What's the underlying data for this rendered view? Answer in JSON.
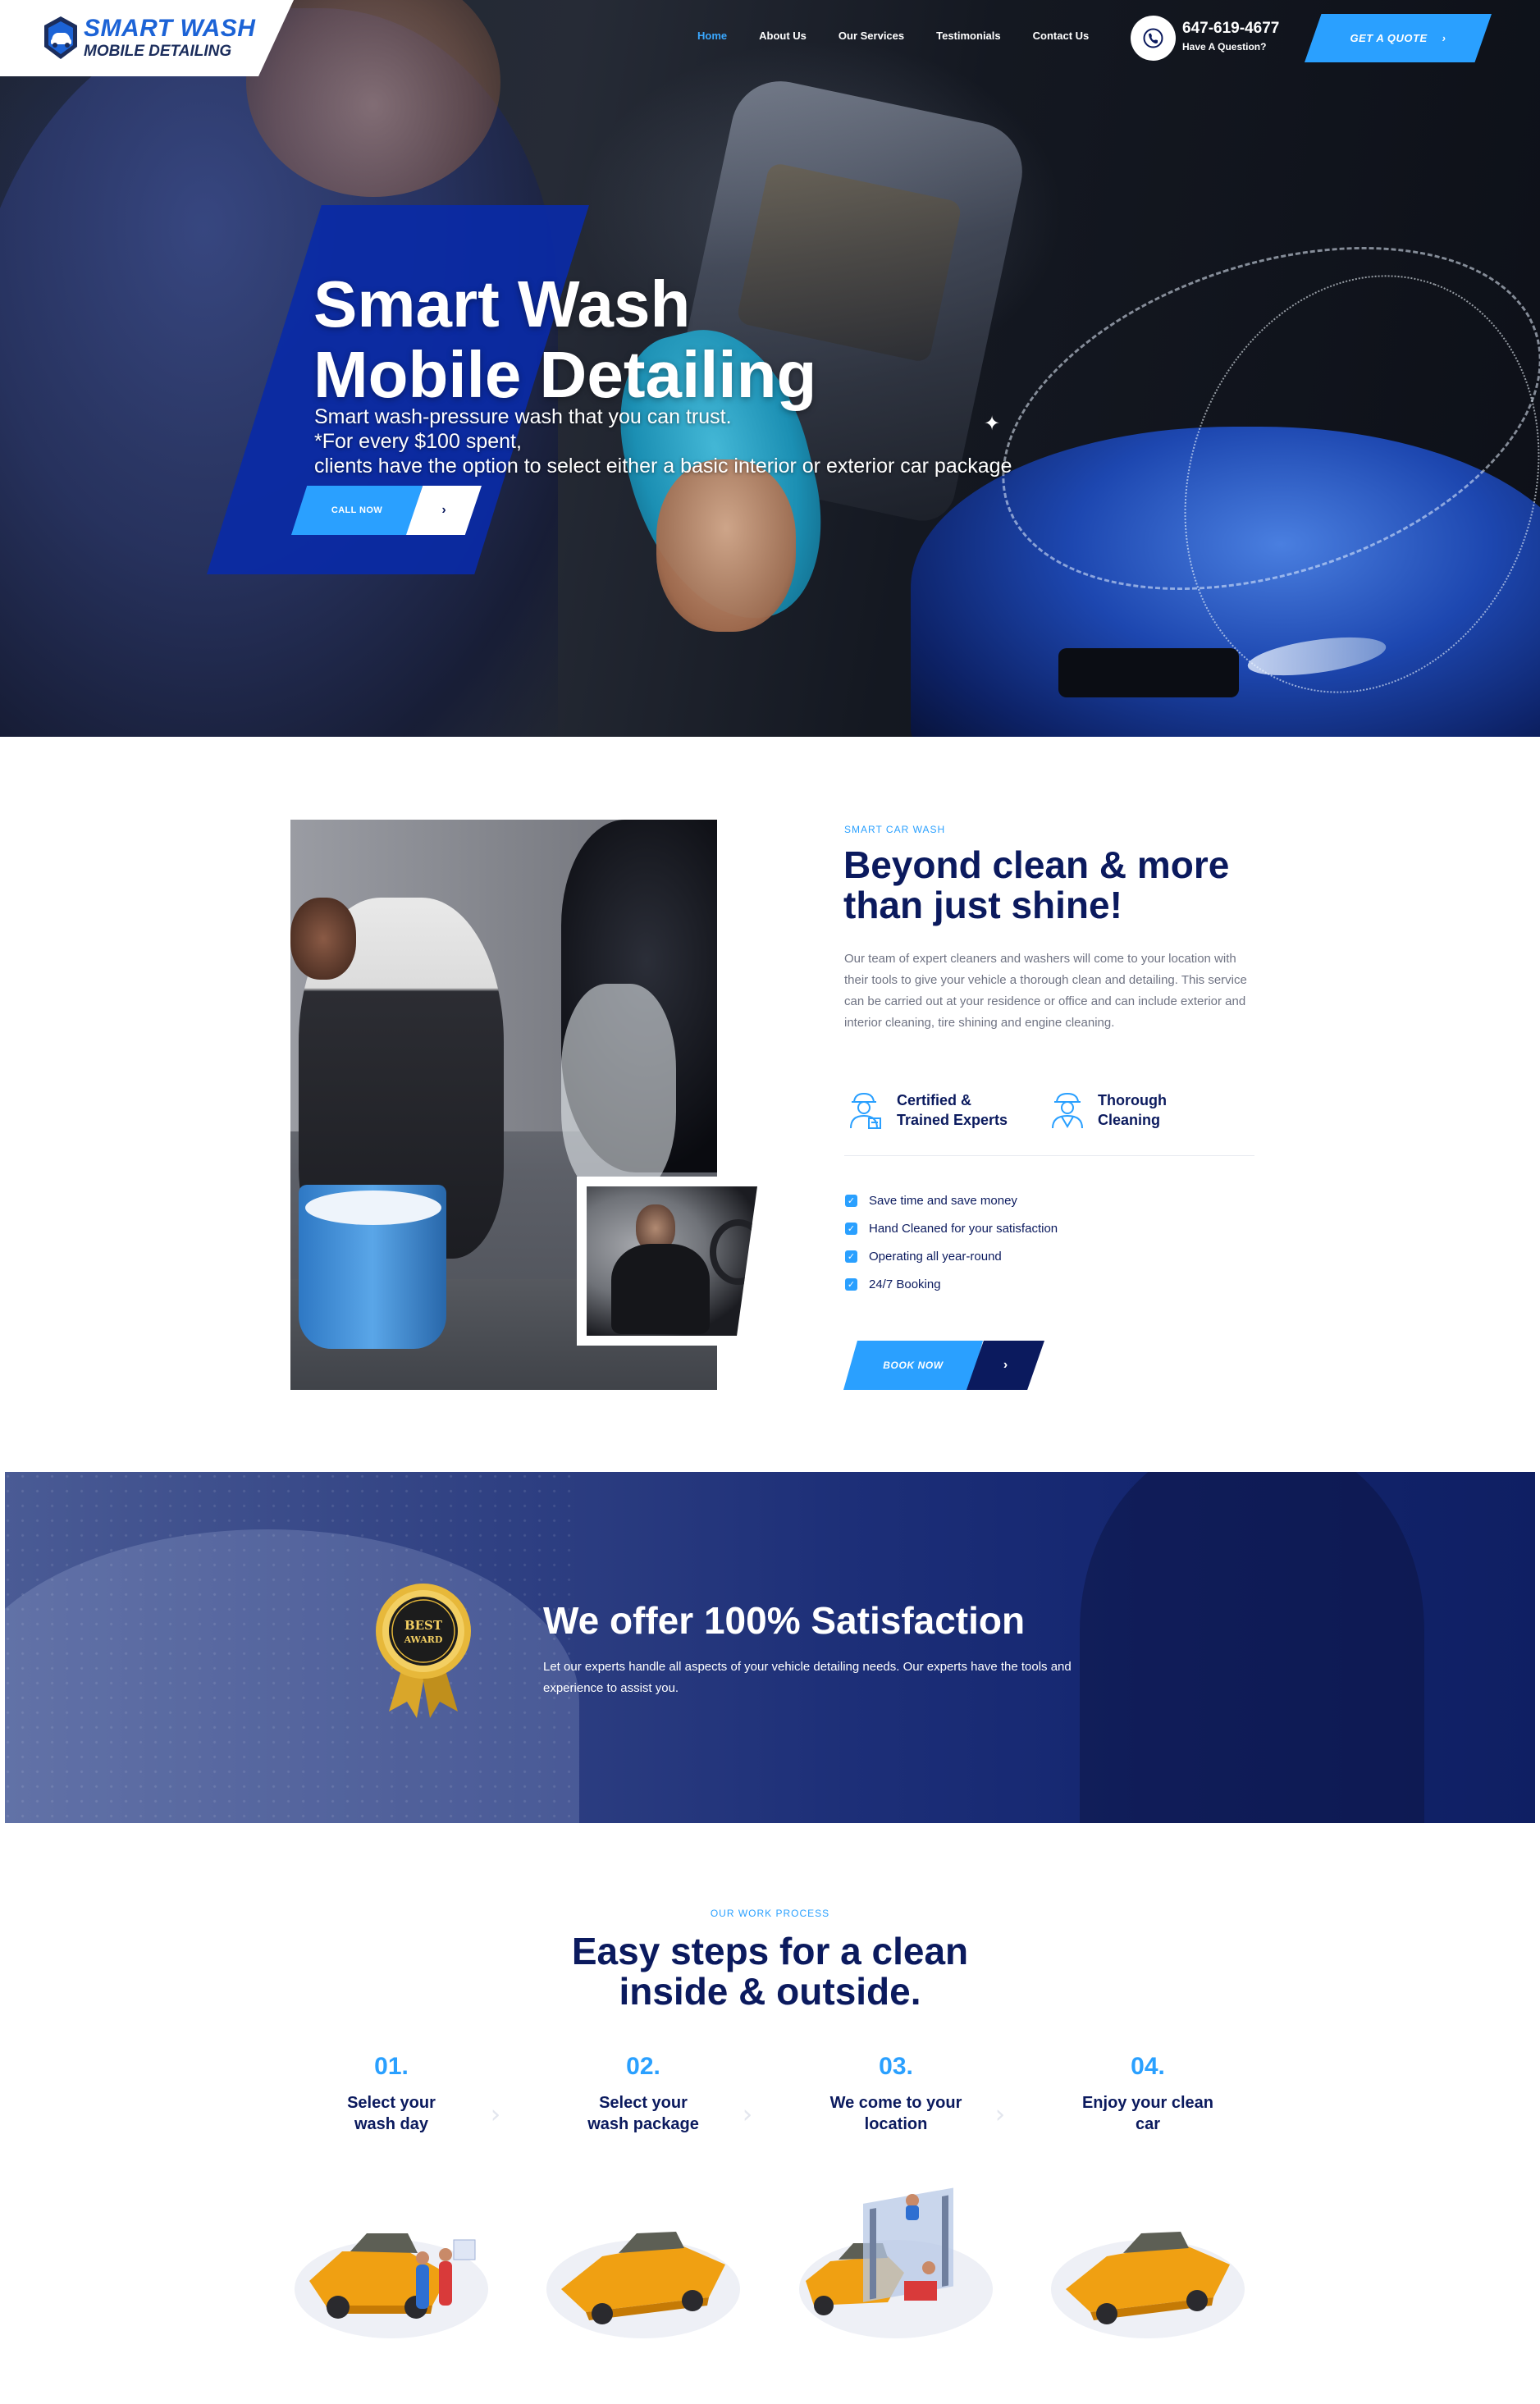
{
  "header": {
    "logo_title": "SMART WASH",
    "logo_subtitle": "MOBILE DETAILING",
    "nav": [
      "Home",
      "About Us",
      "Our Services",
      "Testimonials",
      "Contact Us"
    ],
    "active_nav": "Home",
    "phone": "647-619-4677",
    "phone_caption": "Have A Question?",
    "quote_button": "GET A QUOTE"
  },
  "hero": {
    "title_line1": "Smart Wash",
    "title_line2": "Mobile Detailing",
    "text_line1": "Smart wash-pressure wash that you can trust.",
    "text_line2": "*For every $100 spent,",
    "text_line3": "clients have the option to select either a basic interior or exterior car package",
    "button": "CALL NOW"
  },
  "about": {
    "eyebrow": "SMART CAR WASH",
    "title_line1": "Beyond clean & more",
    "title_line2": "than just shine!",
    "description": "Our team of expert cleaners and washers will come to your location with their tools to give your vehicle a thorough clean and detailing. This service can be carried out at your residence or office and can include exterior and interior cleaning, tire shining and engine cleaning.",
    "features": [
      {
        "line1": "Certified &",
        "line2": "Trained Experts",
        "icon": "worker-icon"
      },
      {
        "line1": "Thorough",
        "line2": "Cleaning",
        "icon": "cleaner-icon"
      }
    ],
    "checklist": [
      "Save time and save money",
      "Hand Cleaned for your satisfaction",
      "Operating all year-round",
      "24/7 Booking"
    ],
    "button": "BOOK NOW"
  },
  "banner": {
    "badge_line1": "BEST",
    "badge_line2": "AWARD",
    "title": "We offer 100% Satisfaction",
    "text": "Let our experts handle all aspects of your vehicle detailing needs. Our experts have the tools and experience to assist you."
  },
  "process": {
    "eyebrow": "OUR WORK PROCESS",
    "title_line1": "Easy steps for a clean",
    "title_line2": "inside & outside.",
    "steps": [
      {
        "num": "01.",
        "line1": "Select your",
        "line2": "wash day"
      },
      {
        "num": "02.",
        "line1": "Select your",
        "line2": "wash package"
      },
      {
        "num": "03.",
        "line1": "We come to your",
        "line2": "location"
      },
      {
        "num": "04.",
        "line1": "Enjoy your clean",
        "line2": "car"
      }
    ]
  },
  "colors": {
    "accent": "#2aa0ff",
    "navy": "#0b1a5e",
    "hero_blue": "#0a2aa6",
    "gold": "#d9a62a"
  }
}
